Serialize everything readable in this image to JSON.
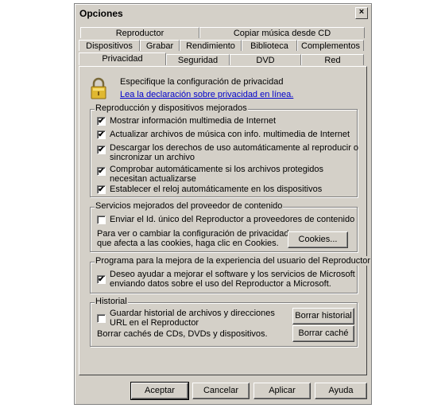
{
  "window": {
    "title": "Opciones",
    "close_glyph": "×"
  },
  "tabs": {
    "row1": [
      "Reproductor",
      "Copiar música desde CD"
    ],
    "row2": [
      "Dispositivos",
      "Grabar",
      "Rendimiento",
      "Biblioteca",
      "Complementos"
    ],
    "row3": [
      "Privacidad",
      "Seguridad",
      "DVD",
      "Red"
    ],
    "active": "Privacidad"
  },
  "header": {
    "text": "Especifique la configuración de privacidad",
    "link": "Lea la declaración sobre privacidad en línea.",
    "icon": "lock-icon"
  },
  "groups": {
    "playback": {
      "title": "Reproducción y dispositivos mejorados",
      "items": [
        {
          "label": "Mostrar información multimedia de Internet",
          "checked": true
        },
        {
          "label": "Actualizar archivos de música con info. multimedia de Internet",
          "checked": true
        },
        {
          "label": "Descargar los derechos de uso automáticamente al reproducir o",
          "label2": "sincronizar un archivo",
          "checked": true
        },
        {
          "label": "Comprobar automáticamente si los archivos protegidos",
          "label2": "necesitan actualizarse",
          "checked": true
        },
        {
          "label": "Establecer el reloj automáticamente en los dispositivos",
          "checked": true
        }
      ]
    },
    "provider": {
      "title": "Servicios mejorados del proveedor de contenido",
      "checkbox": {
        "label": "Enviar el Id. único del Reproductor a proveedores de contenido",
        "checked": false
      },
      "text1": "Para ver o cambiar la configuración de privacidad",
      "text2": "que afecta a las cookies, haga clic en Cookies.",
      "button": "Cookies..."
    },
    "ceip": {
      "title": "Programa para la mejora de la experiencia del usuario del Reproductor",
      "checkbox": {
        "label": "Deseo ayudar a mejorar el software y los servicios de Microsoft",
        "label2": "enviando datos sobre el uso del Reproductor a Microsoft.",
        "checked": true
      }
    },
    "history": {
      "title": "Historial",
      "checkbox": {
        "label": "Guardar historial de archivos y direcciones",
        "label2": "URL en el Reproductor",
        "checked": false
      },
      "text": "Borrar cachés de CDs, DVDs y dispositivos.",
      "clear_history": "Borrar historial",
      "clear_cache": "Borrar caché"
    }
  },
  "footer": {
    "ok": "Aceptar",
    "cancel": "Cancelar",
    "apply": "Aplicar",
    "help": "Ayuda"
  },
  "check_glyph": "✔"
}
